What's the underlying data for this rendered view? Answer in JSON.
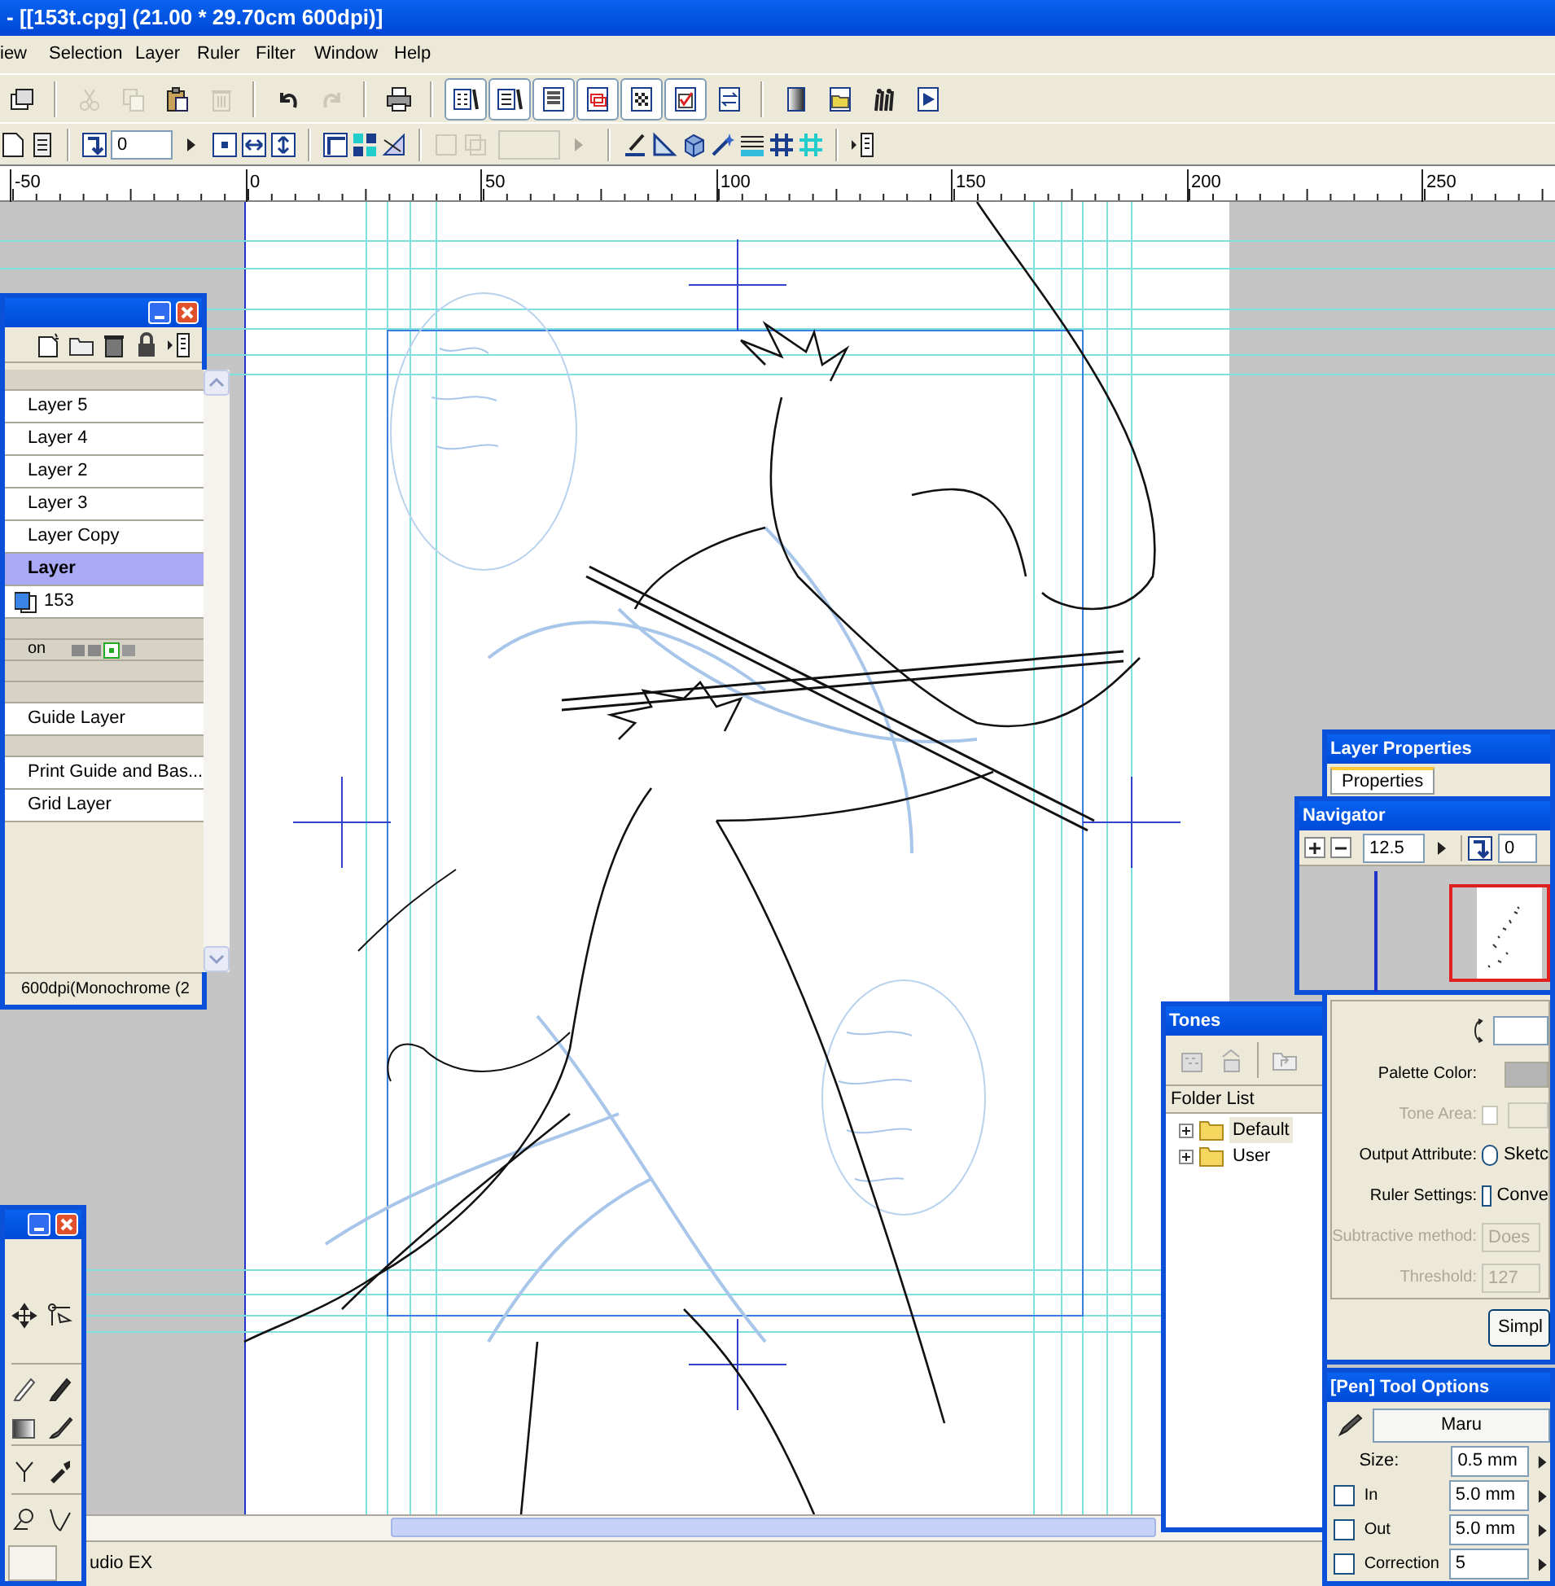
{
  "window": {
    "title": "- [[153t.cpg] (21.00 * 29.70cm 600dpi)]"
  },
  "menu": [
    "iew",
    "Selection",
    "Layer",
    "Ruler",
    "Filter",
    "Window",
    "Help"
  ],
  "main_toolbar": [
    [
      {
        "disabled": false,
        "pressed": false
      }
    ],
    [
      {
        "disabled": true,
        "pressed": false
      },
      {
        "disabled": true,
        "pressed": false
      },
      {
        "disabled": false,
        "pressed": false
      },
      {
        "disabled": true,
        "pressed": false
      }
    ],
    [
      {
        "disabled": false,
        "pressed": false
      },
      {
        "disabled": true,
        "pressed": false
      }
    ],
    [
      {
        "disabled": false,
        "pressed": false
      }
    ],
    [
      {
        "disabled": false,
        "pressed": true
      },
      {
        "disabled": false,
        "pressed": true
      },
      {
        "disabled": false,
        "pressed": true
      },
      {
        "disabled": false,
        "pressed": true
      },
      {
        "disabled": false,
        "pressed": true
      },
      {
        "disabled": false,
        "pressed": true
      },
      {
        "disabled": false,
        "pressed": false
      }
    ],
    [
      {
        "disabled": false,
        "pressed": false
      },
      {
        "disabled": false,
        "pressed": false
      },
      {
        "disabled": false,
        "pressed": false
      },
      {
        "disabled": false,
        "pressed": false
      }
    ]
  ],
  "sub_toolbar": {
    "angle_value": "0",
    "flip_disabled": false,
    "size_disabled": true
  },
  "ruler": [
    "-50",
    "0",
    "50",
    "100",
    "150",
    "200",
    "250"
  ],
  "layer_palette": {
    "rows": [
      {
        "kind": "header"
      },
      {
        "kind": "layer",
        "name": "Layer 5",
        "selected": false
      },
      {
        "kind": "layer",
        "name": "Layer 4",
        "selected": false
      },
      {
        "kind": "layer",
        "name": "Layer 2",
        "selected": false
      },
      {
        "kind": "layer",
        "name": "Layer 3",
        "selected": false
      },
      {
        "kind": "layer",
        "name": "Layer Copy",
        "selected": false
      },
      {
        "kind": "layer",
        "name": "Layer",
        "selected": true
      },
      {
        "kind": "color_layer",
        "name": "153",
        "selected": false
      },
      {
        "kind": "header"
      },
      {
        "kind": "header",
        "label": "on"
      },
      {
        "kind": "header"
      },
      {
        "kind": "header"
      },
      {
        "kind": "layer",
        "name": "Guide Layer",
        "selected": false
      },
      {
        "kind": "header"
      },
      {
        "kind": "layer",
        "name": "Print Guide and Bas...",
        "selected": false
      },
      {
        "kind": "layer",
        "name": "Grid Layer",
        "selected": false
      }
    ],
    "status": "600dpi(Monochrome (2"
  },
  "layer_properties": {
    "title": "Layer Properties",
    "tab": {
      "label": "Properties",
      "selected": true
    },
    "rows": [
      {
        "kind": "icon_field"
      },
      {
        "kind": "swatch",
        "label": "Palette Color:",
        "disabled": false
      },
      {
        "kind": "check_field",
        "label": "Tone Area:",
        "disabled": true,
        "checked": false
      },
      {
        "kind": "radio",
        "label": "Output Attribute:",
        "option": "Sketc",
        "selected": false
      },
      {
        "kind": "checkbox",
        "label": "Ruler Settings:",
        "option": "Conve",
        "checked": false
      },
      {
        "kind": "field",
        "label": "Subtractive method:",
        "value": "Does",
        "disabled": true
      },
      {
        "kind": "field",
        "label": "Threshold:",
        "value": "127",
        "disabled": true
      }
    ],
    "button": "Simpl"
  },
  "navigator": {
    "title": "Navigator",
    "zoom": "12.5",
    "angle": "0"
  },
  "tones": {
    "title": "Tones",
    "header": "Folder List",
    "folders": [
      {
        "label": "Default",
        "selected": true,
        "expanded": false
      },
      {
        "label": "User",
        "selected": false,
        "expanded": false
      }
    ]
  },
  "pen_options": {
    "title": "[Pen] Tool Options",
    "brush": "Maru",
    "rows": [
      {
        "kind": "plain",
        "label": "Size:",
        "value": "0.5 mm"
      },
      {
        "kind": "check",
        "label": "In",
        "value": "5.0 mm",
        "checked": false
      },
      {
        "kind": "check",
        "label": "Out",
        "value": "5.0 mm",
        "checked": false
      },
      {
        "kind": "check",
        "label": "Correction",
        "value": "5",
        "checked": false
      }
    ]
  },
  "status_bar": "udio EX"
}
